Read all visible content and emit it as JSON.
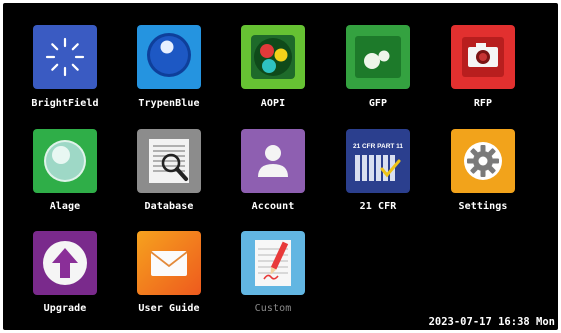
{
  "apps": [
    {
      "key": "brightfield",
      "label": "BrightField",
      "icon": "sun-burst-icon",
      "color": "#3b5cc4",
      "enabled": true
    },
    {
      "key": "trypenblue",
      "label": "TrypenBlue",
      "icon": "blue-cell-icon",
      "color": "#1f8fdd",
      "enabled": true
    },
    {
      "key": "aopi",
      "label": "AOPI",
      "icon": "fluorescent-cells-icon",
      "color": "#5fbf2e",
      "enabled": true
    },
    {
      "key": "gfp",
      "label": "GFP",
      "icon": "green-cells-icon",
      "color": "#2f9e3b",
      "enabled": true
    },
    {
      "key": "rfp",
      "label": "RFP",
      "icon": "camera-icon",
      "color": "#e0302f",
      "enabled": true
    },
    {
      "key": "alage",
      "label": "Alage",
      "icon": "algae-cell-icon",
      "color": "#2fae48",
      "enabled": true
    },
    {
      "key": "database",
      "label": "Database",
      "icon": "database-search-icon",
      "color": "#8a8a8a",
      "enabled": true
    },
    {
      "key": "account",
      "label": "Account",
      "icon": "user-account-icon",
      "color": "#8d5fb0",
      "enabled": true
    },
    {
      "key": "cfr",
      "label": "21 CFR",
      "icon": "compliance-chart-icon",
      "color": "#2b3f8e",
      "enabled": true,
      "badge": "21 CFR PART 11"
    },
    {
      "key": "settings",
      "label": "Settings",
      "icon": "gear-icon",
      "color": "#f1a21a",
      "enabled": true
    },
    {
      "key": "upgrade",
      "label": "Upgrade",
      "icon": "upgrade-arrow-icon",
      "color": "#7a2a8a",
      "enabled": true
    },
    {
      "key": "userguide",
      "label": "User Guide",
      "icon": "envelope-icon",
      "color": "#f07a1e",
      "enabled": true
    },
    {
      "key": "custom",
      "label": "Custom",
      "icon": "pencil-edit-icon",
      "color": "#5ab0e0",
      "enabled": false
    }
  ],
  "status_bar": {
    "datetime": "2023-07-17 16:38 Mon"
  }
}
